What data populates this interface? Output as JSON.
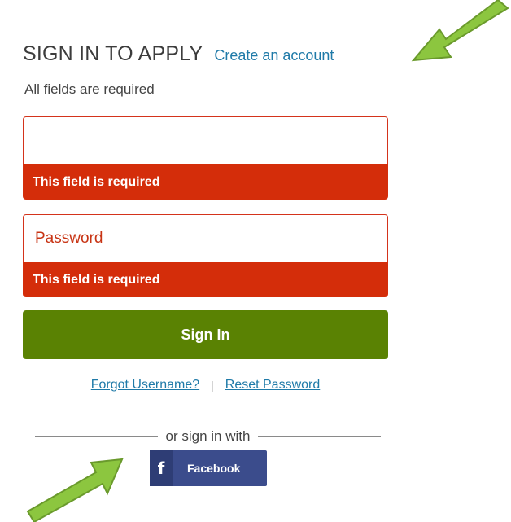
{
  "header": {
    "title": "SIGN IN TO APPLY",
    "create_account": "Create an account",
    "required_note": "All fields are required"
  },
  "form": {
    "username": {
      "value": "",
      "placeholder": "",
      "error": "This field is required"
    },
    "password": {
      "value": "",
      "placeholder": "Password",
      "error": "This field is required"
    },
    "submit_label": "Sign In"
  },
  "links": {
    "forgot_username": "Forgot Username?",
    "separator": "|",
    "reset_password": "Reset Password"
  },
  "social": {
    "divider_text": "or sign in with",
    "facebook_icon": "facebook-f-icon",
    "facebook_label": "Facebook"
  },
  "colors": {
    "accent_link": "#1f7aa8",
    "error": "#d42d0a",
    "primary_button": "#5a8203",
    "facebook": "#3b4c8c",
    "annotation_arrow": "#8cc63f"
  }
}
